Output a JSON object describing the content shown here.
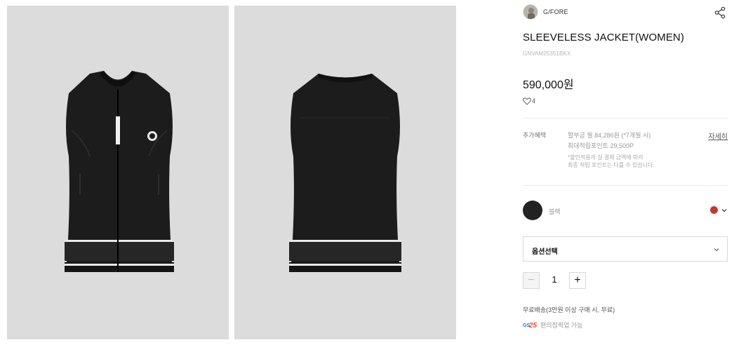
{
  "gallery": {
    "images": [
      {
        "name": "front-view",
        "alt": "front view"
      },
      {
        "name": "back-view",
        "alt": "back view"
      }
    ]
  },
  "product": {
    "brand": "G/FORE",
    "title": "SLEEVELESS JACKET(WOMEN)",
    "code": "GNVAM25351BKX",
    "price": "590,000원",
    "likes": "4"
  },
  "benefits": {
    "label": "추가혜택",
    "installment": "할부금 월 84,286원 (*7개월 시)",
    "points": "최대적립포인트 29,500P",
    "note_line1": "*할인적용과 실 결제 금액에 따라",
    "note_line2": "최종 적립 포인트는 다를 수 있습니다.",
    "detail_link": "자세히"
  },
  "color": {
    "name": "블랙",
    "swatch": "#222222",
    "indicator": "#c23b33"
  },
  "option": {
    "placeholder": "옵션선택"
  },
  "quantity": {
    "minus": "−",
    "value": "1",
    "plus": "+"
  },
  "shipping": {
    "text": "무료배송(3만원 이상 구매 시, 무료)",
    "gs_logo": "GS25",
    "gs_text": "편의점픽업 가능"
  },
  "icons": {
    "share": "share-icon",
    "like": "heart-icon",
    "chevron": "chevron-down-icon"
  }
}
